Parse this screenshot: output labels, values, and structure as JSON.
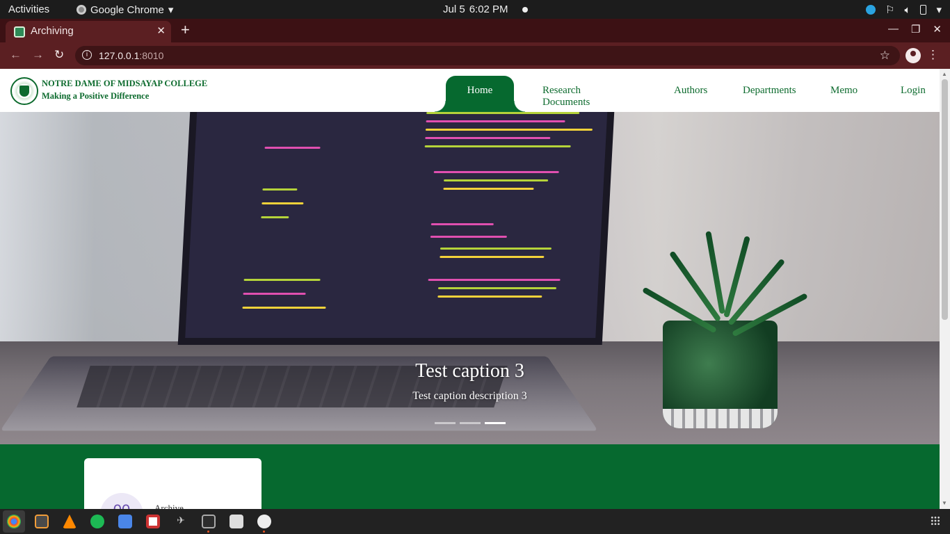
{
  "system_bar": {
    "activities": "Activities",
    "app_name": "Google Chrome",
    "date": "Jul 5",
    "time": "6:02 PM"
  },
  "browser": {
    "tab_title": "Archiving",
    "url_host": "127.0.0.1",
    "url_port": ":8010"
  },
  "site": {
    "brand_name": "NOTRE DAME OF MIDSAYAP COLLEGE",
    "brand_tagline": "Making a Positive Difference",
    "nav": {
      "home": "Home",
      "research": "Research Documents",
      "authors": "Authors",
      "departments": "Departments",
      "memo": "Memo",
      "login": "Login"
    },
    "carousel": {
      "caption_title": "Test caption 3",
      "caption_desc": "Test caption description 3",
      "slide_count": 3,
      "active_slide": 3
    },
    "card": {
      "icon_text": "00",
      "label": "Archive"
    }
  },
  "colors": {
    "brand_green": "#06692f",
    "tab_strip": "#3c1114",
    "toolbar": "#5b1f22"
  }
}
